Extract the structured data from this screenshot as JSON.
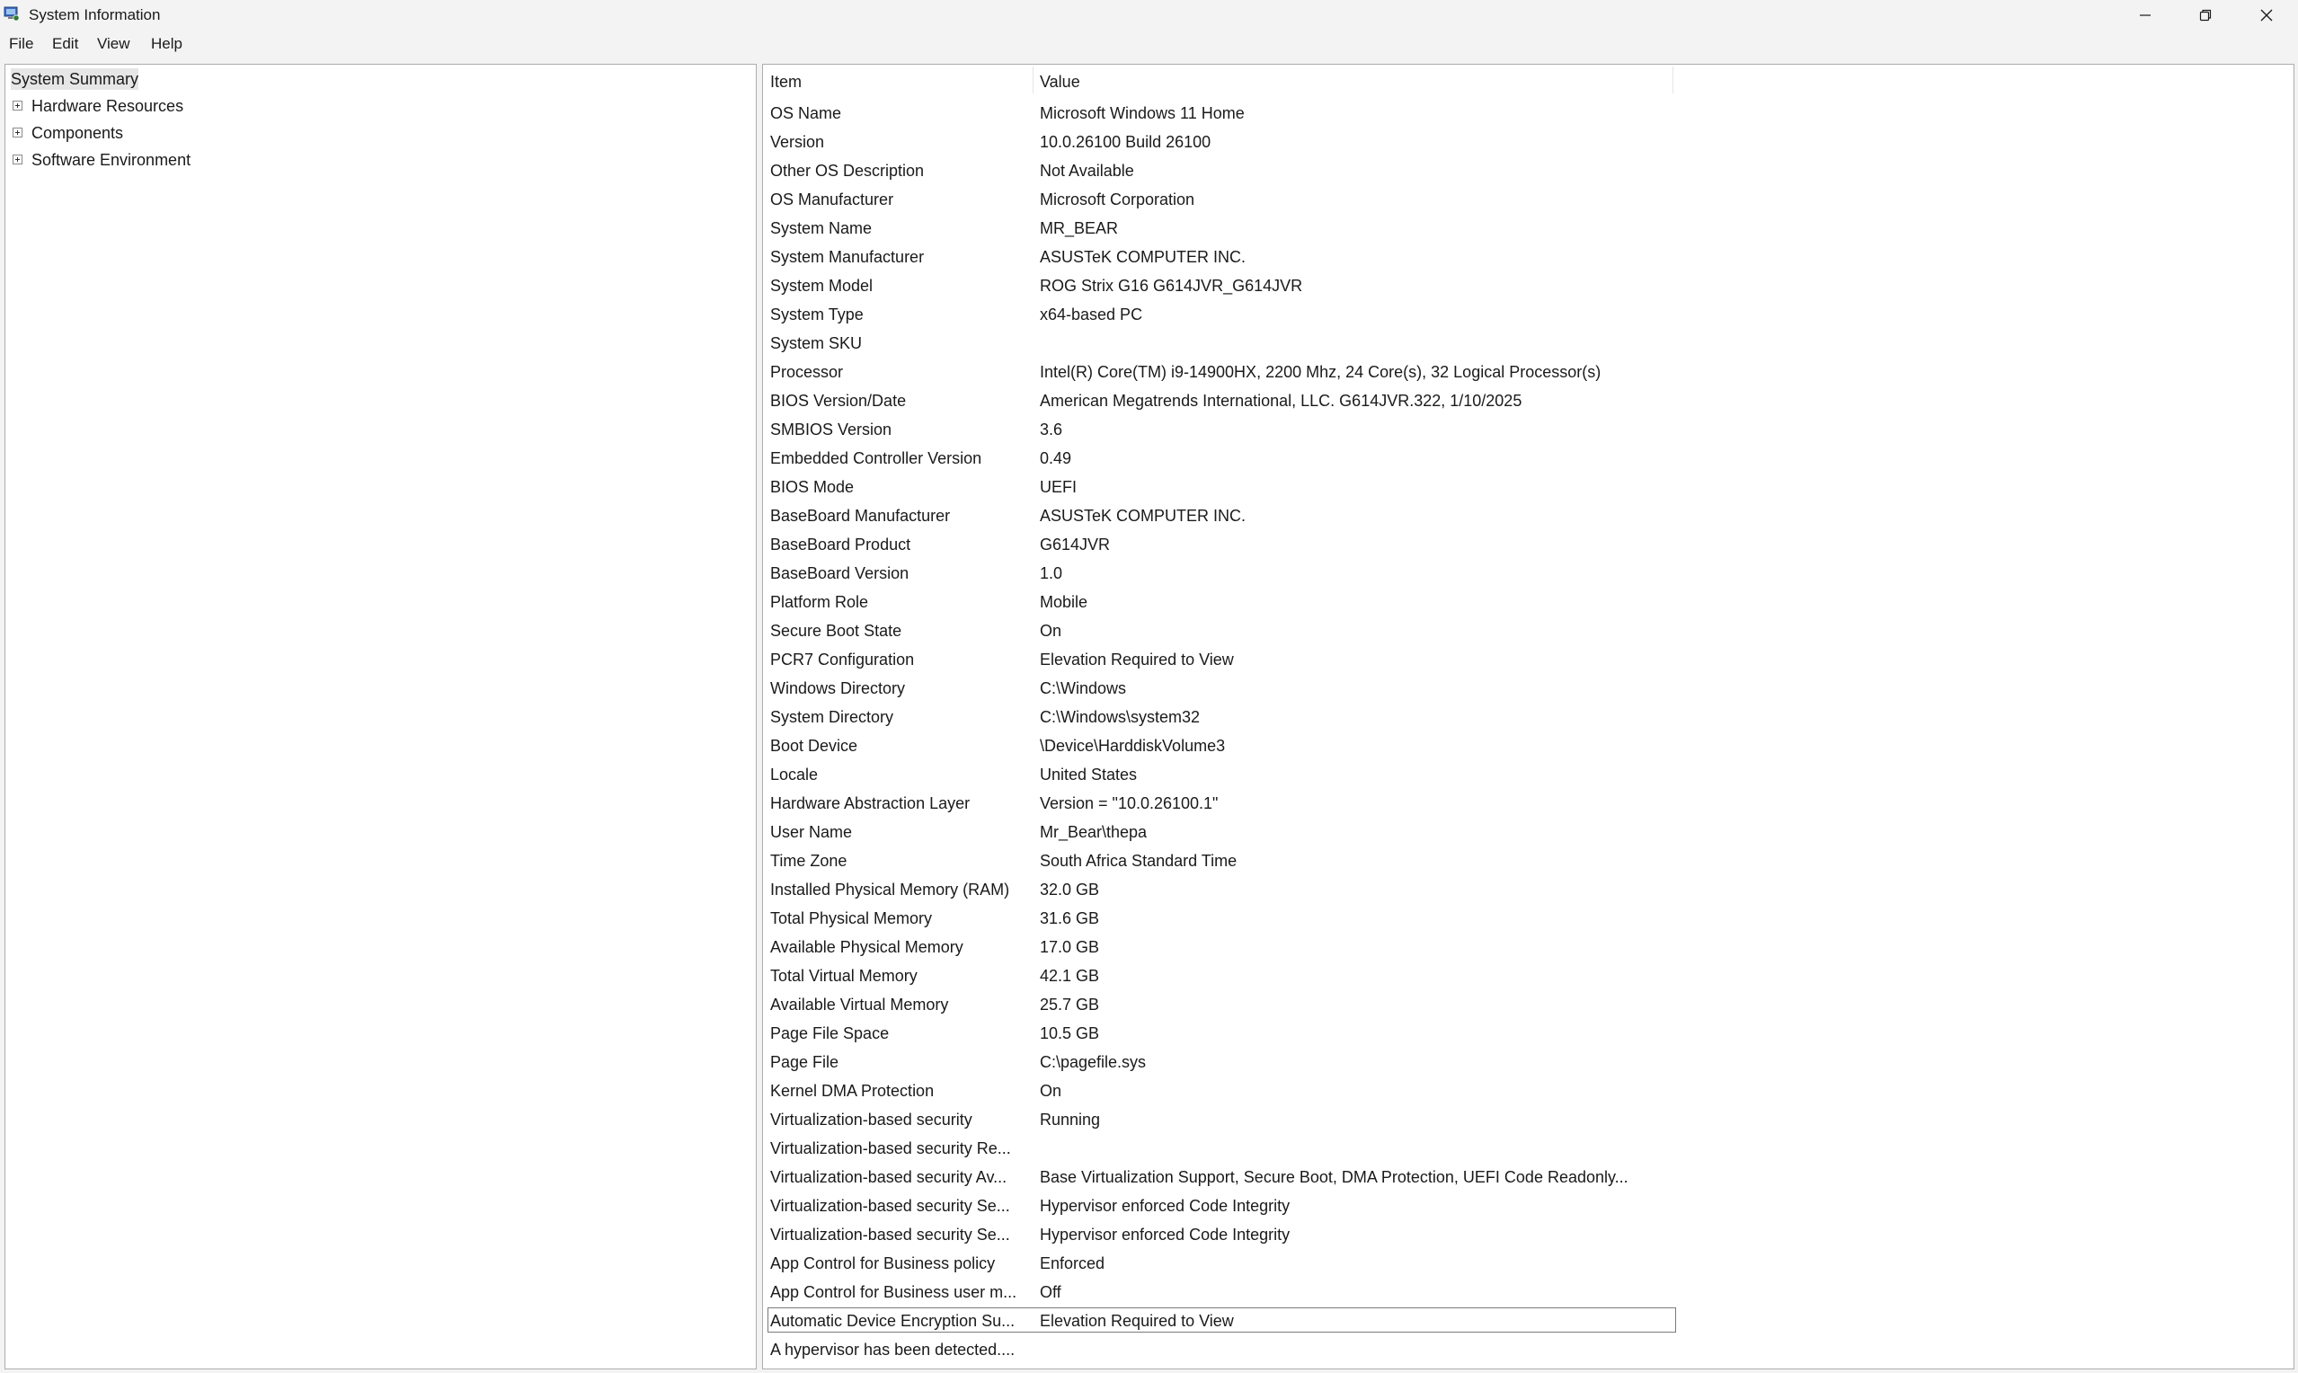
{
  "window": {
    "title": "System Information",
    "icon": "system-information-icon"
  },
  "menu": [
    "File",
    "Edit",
    "View",
    "Help"
  ],
  "tree": {
    "items": [
      {
        "label": "System Summary",
        "selected": true,
        "expandable": false
      },
      {
        "label": "Hardware Resources",
        "expandable": true
      },
      {
        "label": "Components",
        "expandable": true
      },
      {
        "label": "Software Environment",
        "expandable": true
      }
    ]
  },
  "list": {
    "columns": [
      "Item",
      "Value"
    ],
    "rows": [
      {
        "item": "OS Name",
        "value": "Microsoft Windows 11 Home"
      },
      {
        "item": "Version",
        "value": "10.0.26100 Build 26100"
      },
      {
        "item": "Other OS Description",
        "value": "Not Available"
      },
      {
        "item": "OS Manufacturer",
        "value": "Microsoft Corporation"
      },
      {
        "item": "System Name",
        "value": "MR_BEAR"
      },
      {
        "item": "System Manufacturer",
        "value": "ASUSTeK COMPUTER INC."
      },
      {
        "item": "System Model",
        "value": "ROG Strix G16 G614JVR_G614JVR"
      },
      {
        "item": "System Type",
        "value": "x64-based PC"
      },
      {
        "item": "System SKU",
        "value": ""
      },
      {
        "item": "Processor",
        "value": "Intel(R) Core(TM) i9-14900HX, 2200 Mhz, 24 Core(s), 32 Logical Processor(s)"
      },
      {
        "item": "BIOS Version/Date",
        "value": "American Megatrends International, LLC. G614JVR.322, 1/10/2025"
      },
      {
        "item": "SMBIOS Version",
        "value": "3.6"
      },
      {
        "item": "Embedded Controller Version",
        "value": "0.49"
      },
      {
        "item": "BIOS Mode",
        "value": "UEFI"
      },
      {
        "item": "BaseBoard Manufacturer",
        "value": "ASUSTeK COMPUTER INC."
      },
      {
        "item": "BaseBoard Product",
        "value": "G614JVR"
      },
      {
        "item": "BaseBoard Version",
        "value": "1.0"
      },
      {
        "item": "Platform Role",
        "value": "Mobile"
      },
      {
        "item": "Secure Boot State",
        "value": "On"
      },
      {
        "item": "PCR7 Configuration",
        "value": "Elevation Required to View"
      },
      {
        "item": "Windows Directory",
        "value": "C:\\Windows"
      },
      {
        "item": "System Directory",
        "value": "C:\\Windows\\system32"
      },
      {
        "item": "Boot Device",
        "value": "\\Device\\HarddiskVolume3"
      },
      {
        "item": "Locale",
        "value": "United States"
      },
      {
        "item": "Hardware Abstraction Layer",
        "value": "Version = \"10.0.26100.1\""
      },
      {
        "item": "User Name",
        "value": "Mr_Bear\\thepa"
      },
      {
        "item": "Time Zone",
        "value": "South Africa Standard Time"
      },
      {
        "item": "Installed Physical Memory (RAM)",
        "value": "32.0 GB"
      },
      {
        "item": "Total Physical Memory",
        "value": "31.6 GB"
      },
      {
        "item": "Available Physical Memory",
        "value": "17.0 GB"
      },
      {
        "item": "Total Virtual Memory",
        "value": "42.1 GB"
      },
      {
        "item": "Available Virtual Memory",
        "value": "25.7 GB"
      },
      {
        "item": "Page File Space",
        "value": "10.5 GB"
      },
      {
        "item": "Page File",
        "value": "C:\\pagefile.sys"
      },
      {
        "item": "Kernel DMA Protection",
        "value": "On"
      },
      {
        "item": "Virtualization-based security",
        "value": "Running"
      },
      {
        "item": "Virtualization-based security Re...",
        "value": ""
      },
      {
        "item": "Virtualization-based security Av...",
        "value": "Base Virtualization Support, Secure Boot, DMA Protection, UEFI Code Readonly..."
      },
      {
        "item": "Virtualization-based security Se...",
        "value": "Hypervisor enforced Code Integrity"
      },
      {
        "item": "Virtualization-based security Se...",
        "value": "Hypervisor enforced Code Integrity"
      },
      {
        "item": "App Control for Business policy",
        "value": "Enforced"
      },
      {
        "item": "App Control for Business user m...",
        "value": "Off"
      },
      {
        "item": "Automatic Device Encryption Su...",
        "value": "Elevation Required to View",
        "focused": true
      },
      {
        "item": "A hypervisor has been detected....",
        "value": ""
      }
    ]
  },
  "colors": {
    "background": "#f3f3f3",
    "pane": "#ffffff",
    "border": "#adadad"
  }
}
